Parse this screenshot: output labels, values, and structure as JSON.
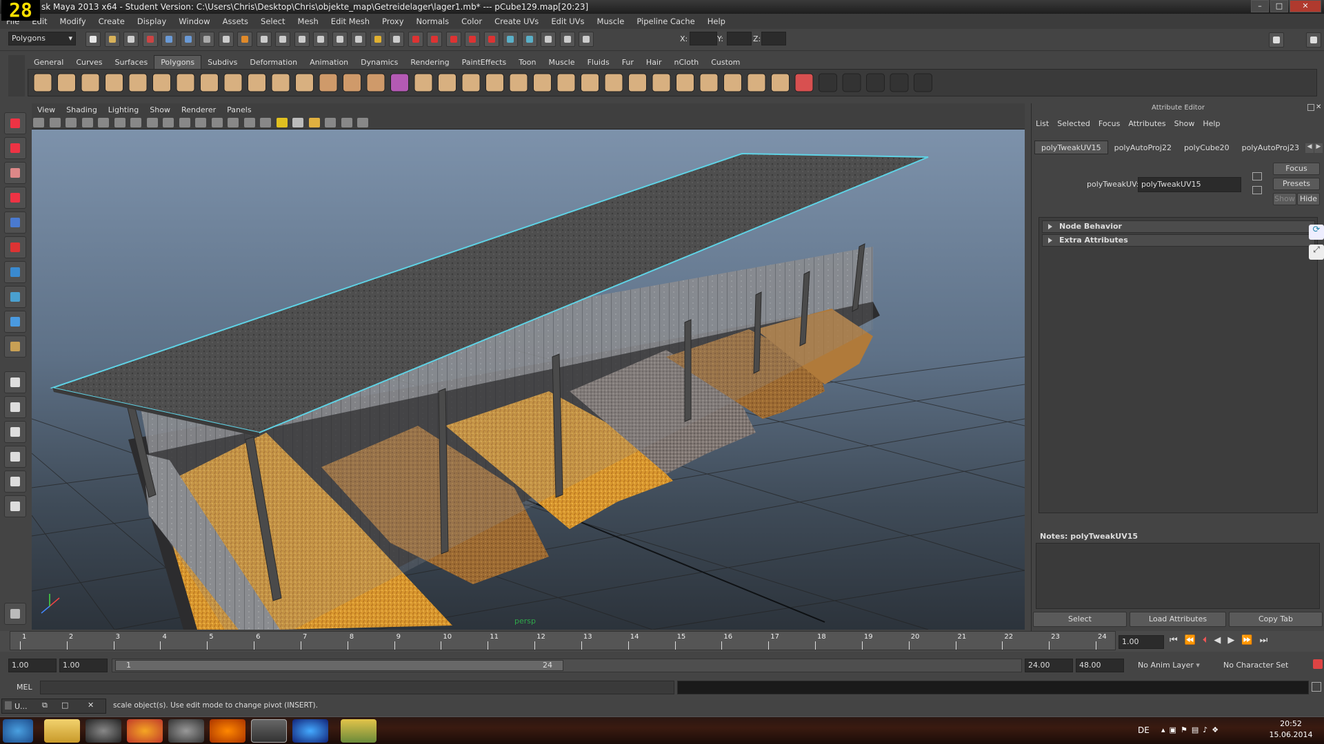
{
  "fps": "28",
  "window": {
    "title": "sk Maya 2013 x64 - Student Version: C:\\Users\\Chris\\Desktop\\Chris\\objekte_map\\Getreidelager\\lager1.mb*  ---  pCube129.map[20:23]",
    "minimize": "–",
    "maximize": "□",
    "close": "✕"
  },
  "menu": [
    "File",
    "Edit",
    "Modify",
    "Create",
    "Display",
    "Window",
    "Assets",
    "Select",
    "Mesh",
    "Edit Mesh",
    "Proxy",
    "Normals",
    "Color",
    "Create UVs",
    "Edit UVs",
    "Muscle",
    "Pipeline Cache",
    "Help"
  ],
  "status_line": {
    "mode": "Polygons",
    "x_label": "X:",
    "y_label": "Y:",
    "z_label": "Z:"
  },
  "shelf_tabs": [
    "General",
    "Curves",
    "Surfaces",
    "Polygons",
    "Subdivs",
    "Deformation",
    "Animation",
    "Dynamics",
    "Rendering",
    "PaintEffects",
    "Toon",
    "Muscle",
    "Fluids",
    "Fur",
    "Hair",
    "nCloth",
    "Custom"
  ],
  "shelf_active": "Polygons",
  "viewport_menu": [
    "View",
    "Shading",
    "Lighting",
    "Show",
    "Renderer",
    "Panels"
  ],
  "viewport_label": "persp",
  "attribute_editor": {
    "title": "Attribute Editor",
    "menu": [
      "List",
      "Selected",
      "Focus",
      "Attributes",
      "Show",
      "Help"
    ],
    "tabs": [
      "polyTweakUV15",
      "polyAutoProj22",
      "polyCube20",
      "polyAutoProj23"
    ],
    "field_label": "polyTweakUV:",
    "field_value": "polyTweakUV15",
    "buttons": {
      "focus": "Focus",
      "presets": "Presets",
      "show": "Show",
      "hide": "Hide"
    },
    "sections": [
      "Node Behavior",
      "Extra Attributes"
    ],
    "notes_label": "Notes: polyTweakUV15",
    "bottom_buttons": [
      "Select",
      "Load Attributes",
      "Copy Tab"
    ]
  },
  "time_slider": {
    "ticks": [
      "1",
      "2",
      "3",
      "4",
      "5",
      "6",
      "7",
      "8",
      "9",
      "10",
      "11",
      "12",
      "13",
      "14",
      "15",
      "16",
      "17",
      "18",
      "19",
      "20",
      "21",
      "22",
      "23",
      "24"
    ],
    "current_frame": "1.00"
  },
  "range": {
    "start": "1.00",
    "playback_start": "1.00",
    "slider_left": "1",
    "slider_right": "24",
    "playback_end": "24.00",
    "end": "48.00",
    "anim_layer": "No Anim Layer",
    "character_set": "No Character Set"
  },
  "command_line": {
    "label": "MEL"
  },
  "help_line": {
    "mini_window": "U...",
    "text": "scale object(s). Use edit mode to change pivot (INSERT)."
  },
  "taskbar": {
    "language": "DE",
    "time": "20:52",
    "date": "15.06.2014"
  },
  "colors": {
    "selection_highlight": "#5fd3e6",
    "grain_orange": "#d8972e",
    "roof": "#4e4e4e"
  }
}
